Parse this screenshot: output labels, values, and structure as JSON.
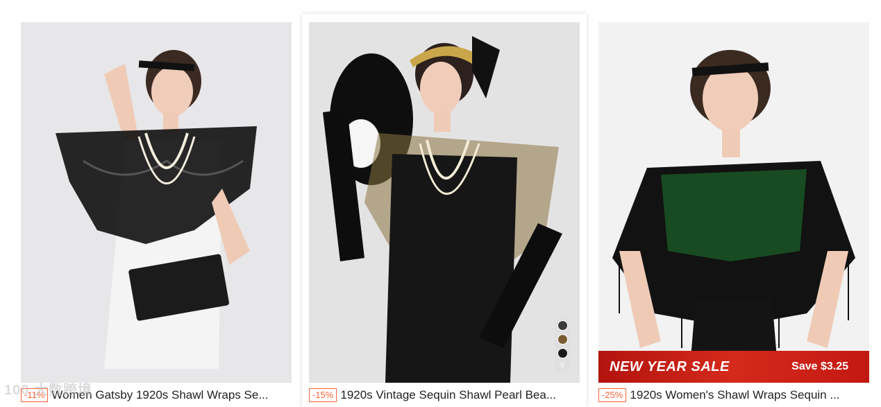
{
  "products": [
    {
      "discount": "-11%",
      "title": "Women Gatsby 1920s Shawl Wraps Se...",
      "image_alt": "woman in white dress with black sequin shawl and pearl necklace",
      "colors": {
        "dress": "#f4f4f4",
        "shawl": "#151515",
        "background": "#e7e6e8"
      }
    },
    {
      "discount": "-15%",
      "title": "1920s Vintage Sequin Shawl Pearl Bea...",
      "image_alt": "woman in black dress with gold sequin shawl, feather fan and gloves",
      "swatch_count": "5",
      "colors": {
        "dress": "#161616",
        "shawl": "#8a7440",
        "background": "#e4e3e4"
      }
    },
    {
      "discount": "-25%",
      "title": "1920s Women's Shawl Wraps Sequin ...",
      "image_alt": "woman in black dress with green sequin fringed shawl",
      "banner_left": "NEW YEAR SALE",
      "banner_right": "Save $3.25",
      "colors": {
        "dress": "#141414",
        "shawl": "#1d7a2d",
        "background": "#f2f2f2"
      }
    }
  ],
  "watermark": "100 大数跨境",
  "accent": "#fa6338"
}
